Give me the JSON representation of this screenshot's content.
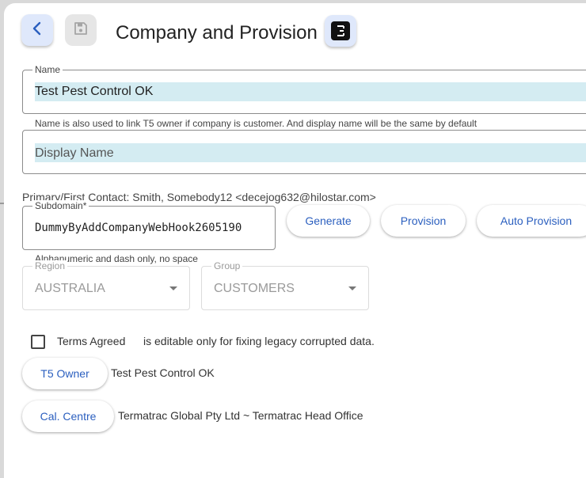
{
  "header": {
    "title": "Company and Provision",
    "icons": {
      "back": "chevron-left-icon",
      "save": "floppy-disk-icon",
      "e": "letter-e-icon"
    },
    "e_badge": "E"
  },
  "name_field": {
    "label": "Name",
    "value": "Test Pest Control OK",
    "helper": "Name is also used to link T5 owner if company is customer. And display name will be the same by default"
  },
  "display_name_field": {
    "placeholder": "Display Name"
  },
  "primary_contact": "Primary/First Contact: Smith, Somebody12 <decejog632@hilostar.com>",
  "subdomain": {
    "label": "Subdomain*",
    "value": "DummyByAddCompanyWebHook2605190",
    "helper": "Alphanumeric and dash only, no space"
  },
  "buttons": {
    "generate": "Generate",
    "provision": "Provision",
    "auto_provision": "Auto Provision"
  },
  "region": {
    "label": "Region",
    "value": "AUSTRALIA"
  },
  "group": {
    "label": "Group",
    "value": "CUSTOMERS"
  },
  "terms": {
    "label": "Terms Agreed",
    "note": "is editable only for fixing legacy corrupted data.",
    "checked": false
  },
  "t5_owner": {
    "button": "T5 Owner",
    "value": "Test Pest Control OK"
  },
  "cal_centre": {
    "button": "Cal. Centre",
    "value": "Termatrac Global Pty Ltd ~ Termatrac Head Office"
  },
  "colors": {
    "accent": "#2b5fbf",
    "field_highlight": "#d4ecf2",
    "icon_button_bg": "#dfe8fb"
  }
}
